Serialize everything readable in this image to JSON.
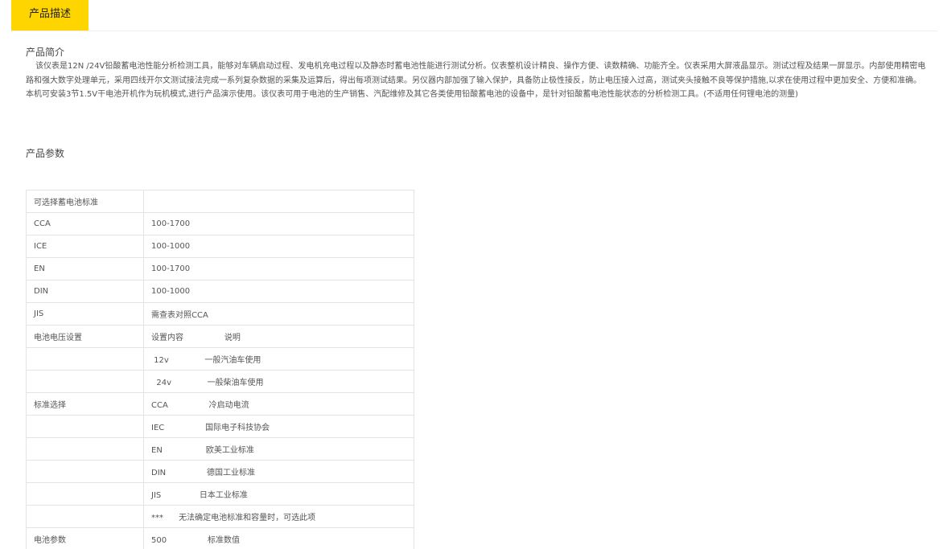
{
  "tabs": {
    "active_label": "产品描述"
  },
  "intro": {
    "heading": "产品简介",
    "body": "该仪表是12N /24V铅酸蓄电池性能分析检测工具，能够对车辆启动过程、发电机充电过程以及静态时蓄电池性能进行测试分析。仪表整机设计精良、操作方便、读数精确、功能齐全。仪表采用大屏液晶显示。测试过程及结果一屏显示。内部使用精密电路和强大数字处理单元，采用四线开尔文测试接法完成一系列复杂数据的采集及运算后，得出每项测试结果。另仪器内部加强了输入保护，具备防止极性接反，防止电压接入过高，测试夹头接触不良等保护措施,以求在使用过程中更加安全、方便和准确。本机可安装3节1.5V干电池开机作为玩机模式,进行产品演示使用。该仪表可用于电池的生产销售、汽配维修及其它各类使用铅酸蓄电池的设备中，是针对铅酸蓄电池性能状态的分析检测工具。(不适用任何锂电池的测量)"
  },
  "params": {
    "heading": "产品参数",
    "rows": [
      {
        "label": "可选择蓄电池标准",
        "value": ""
      },
      {
        "label": "CCA",
        "value": "100-1700"
      },
      {
        "label": "ICE",
        "value": "100-1000"
      },
      {
        "label": "EN",
        "value": "100-1700"
      },
      {
        "label": "DIN",
        "value": "100-1000"
      },
      {
        "label": "JIS",
        "value": "需查表对照CCA"
      },
      {
        "label": "电池电压设置",
        "value": "设置内容                说明"
      },
      {
        "label": "",
        "value": " 12v              一般汽油车使用"
      },
      {
        "label": "",
        "value": "  24v              一般柴油车使用"
      },
      {
        "label": "标准选择",
        "value": "CCA                冷启动电流"
      },
      {
        "label": "",
        "value": "IEC                国际电子科技协会"
      },
      {
        "label": "",
        "value": "EN                 欧美工业标准"
      },
      {
        "label": "",
        "value": "DIN                德国工业标准"
      },
      {
        "label": "",
        "value": "JIS               日本工业标准"
      },
      {
        "label": "",
        "value": "***      无法确定电池标准和容量时，可选此项"
      },
      {
        "label": "电池参数",
        "value": "500                标准数值"
      }
    ]
  }
}
